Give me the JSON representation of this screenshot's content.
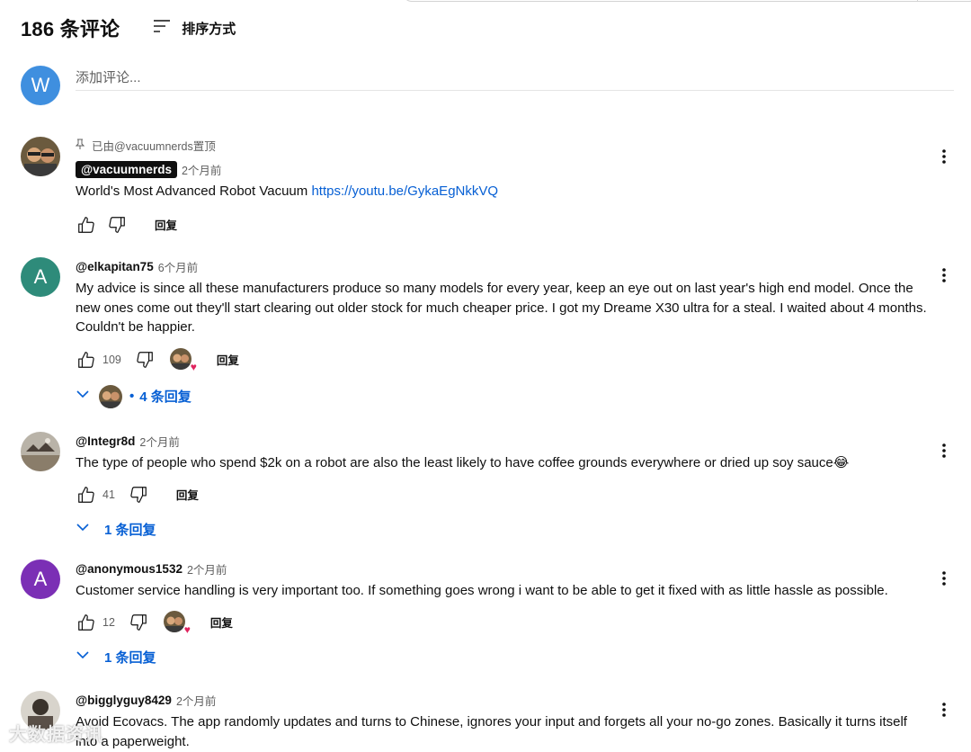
{
  "header": {
    "count_label": "186 条评论",
    "sort_label": "排序方式"
  },
  "add_comment": {
    "avatar_letter": "W",
    "placeholder": "添加评论..."
  },
  "comments": [
    {
      "pinned_label": "已由@vacuumnerds置顶",
      "author": "@vacuumnerds",
      "time": "2个月前",
      "text": "World's Most Advanced Robot Vacuum ",
      "link": "https://youtu.be/GykaEgNkkVQ",
      "reply_label": "回复"
    },
    {
      "avatar_letter": "A",
      "author": "@elkapitan75",
      "time": "6个月前",
      "text": "My advice is since all these manufacturers produce so many models for every year, keep an eye out on last year's high end model. Once the new ones come out they'll start clearing out older stock for much cheaper price. I got my Dreame X30 ultra for a steal. I waited about 4 months. Couldn't be happier.",
      "likes": "109",
      "reply_label": "回复",
      "replies_label": "4 条回复",
      "replies_dot": "•"
    },
    {
      "author": "@Integr8d",
      "time": "2个月前",
      "text": "The type of people who spend $2k on a robot are also the least likely to have coffee grounds everywhere or dried up soy sauce😂",
      "likes": "41",
      "reply_label": "回复",
      "replies_label": "1 条回复"
    },
    {
      "avatar_letter": "A",
      "author": "@anonymous1532",
      "time": "2个月前",
      "text": "Customer service handling is very important too. If something goes wrong i want to be able to get it fixed with as little hassle as possible.",
      "likes": "12",
      "reply_label": "回复",
      "replies_label": "1 条回复"
    },
    {
      "author": "@bigglyguy8429",
      "time": "2个月前",
      "text": "Avoid Ecovacs. The app randomly updates and turns to Chinese, ignores your input and forgets all your no-go zones. Basically it turns itself into a paperweight."
    }
  ],
  "watermark": "大数据资讯",
  "colors": {
    "link": "#065fd4",
    "avatar_w": "#3f8fdf",
    "avatar_teal": "#2e8b7a",
    "avatar_purple": "#7b2fb5",
    "heart": "#e0245e"
  }
}
